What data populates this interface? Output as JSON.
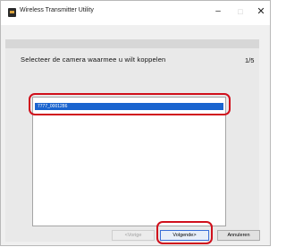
{
  "window": {
    "title": "Wireless Transmitter Utility",
    "minimize_glyph": "–",
    "maximize_glyph": "□",
    "close_glyph": "✕"
  },
  "page": {
    "prompt": "Selecteer de camera waarmee u wilt koppelen",
    "step": "1/5"
  },
  "device_list": {
    "items": [
      {
        "label": "7777_0001286",
        "selected": true
      }
    ]
  },
  "buttons": {
    "prev_label": "<Vorige",
    "next_label": "Volgende>",
    "cancel_label": "Annuleren"
  },
  "colors": {
    "selection": "#1a64cf",
    "highlight_annotation": "#d0101c"
  }
}
